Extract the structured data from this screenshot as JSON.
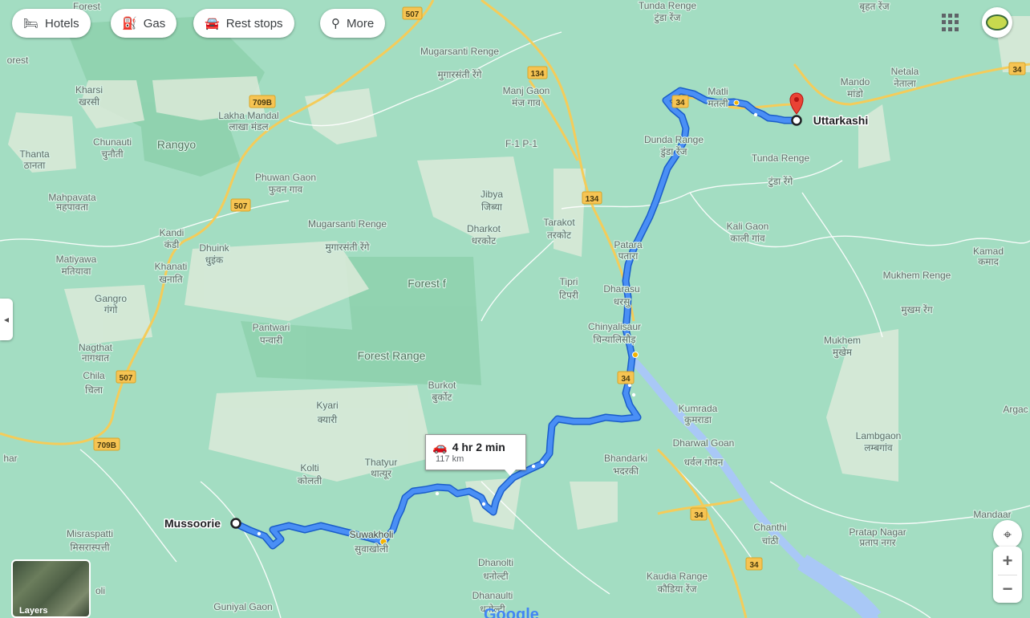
{
  "toolbar": {
    "chips": [
      {
        "label": "Hotels",
        "icon": "bed-icon"
      },
      {
        "label": "Gas",
        "icon": "fuel-icon"
      },
      {
        "label": "Rest stops",
        "icon": "car-icon"
      },
      {
        "label": "More",
        "icon": "search-icon"
      }
    ]
  },
  "route": {
    "origin": "Mussoorie",
    "destination": "Uttarkashi",
    "duration": "4 hr 2 min",
    "distance": "117 km"
  },
  "controls": {
    "layers_label": "Layers",
    "zoom_in": "+",
    "zoom_out": "−",
    "logo": "Google"
  },
  "colors": {
    "route": "#4285f4",
    "route_outline": "#1a5dc9",
    "river": "#aac8f5",
    "terrain_green": "#9fdcbf",
    "terrain_light": "#d2ead8",
    "road_yellow": "#f6c453",
    "pin_red": "#ea4335"
  },
  "road_labels": [
    "507",
    "134",
    "709B",
    "507",
    "507",
    "709B",
    "134",
    "34",
    "34",
    "34",
    "34",
    "34"
  ],
  "places": [
    {
      "en": "Forest"
    },
    {
      "en": "orest"
    },
    {
      "en": "Kharsi",
      "hi": "खरसी"
    },
    {
      "en": "Chunauti",
      "hi": "चुनौती"
    },
    {
      "en": "Rangyo"
    },
    {
      "en": "Thanta",
      "hi": "ठानता"
    },
    {
      "en": "Lakha Mandal",
      "hi": "लाखा मंडल"
    },
    {
      "en": "Mugarsanti Renge",
      "hi": "मुगारसंती रेंगे"
    },
    {
      "en": "Manj Gaon",
      "hi": "मंज गाव"
    },
    {
      "en": "Tunda Renge",
      "hi": "टुंडा रेंज"
    },
    {
      "en": "बृहत रेंज"
    },
    {
      "en": "Matli",
      "hi": "मतली"
    },
    {
      "en": "Mando",
      "hi": "मांडो"
    },
    {
      "en": "Netala",
      "hi": "नेताला"
    },
    {
      "en": "Dunda Range",
      "hi": "डुंडा रेंज"
    },
    {
      "en": "Tunda Renge",
      "hi": "टुंडा रेंगे"
    },
    {
      "en": "F-1 P-1"
    },
    {
      "en": "Phuwan Gaon",
      "hi": "फुवन गाव"
    },
    {
      "en": "Mahpavata",
      "hi": "महपावता"
    },
    {
      "en": "Jibya",
      "hi": "जिब्या"
    },
    {
      "en": "Tarakot",
      "hi": "तरकोट"
    },
    {
      "en": "Dharkot",
      "hi": "धरकोट"
    },
    {
      "en": "Kandi",
      "hi": "कंडी"
    },
    {
      "en": "Dhuink",
      "hi": "धुइंक"
    },
    {
      "en": "Mugarsanti Renge",
      "hi": "मुगारसंती रेंगे"
    },
    {
      "en": "Matiyawa",
      "hi": "मतियावा"
    },
    {
      "en": "Khanati",
      "hi": "खनाति"
    },
    {
      "en": "Patara",
      "hi": "पतारा"
    },
    {
      "en": "Kali Gaon",
      "hi": "काली गांव"
    },
    {
      "en": "Kamad",
      "hi": "कमाद"
    },
    {
      "en": "Forest f"
    },
    {
      "en": "Tipri",
      "hi": "टिपरी"
    },
    {
      "en": "Dharasu",
      "hi": "धरसु"
    },
    {
      "en": "Mukhem Renge",
      "hi": "मुखम रेंग"
    },
    {
      "en": "Gangro",
      "hi": "गंगो"
    },
    {
      "en": "Pantwari",
      "hi": "पन्वारी"
    },
    {
      "en": "Chinyalisaur",
      "hi": "चिन्यालिसौड़"
    },
    {
      "en": "Forest Range"
    },
    {
      "en": "Nagthat",
      "hi": "नागथात"
    },
    {
      "en": "Mukhem",
      "hi": "मुखेम"
    },
    {
      "en": "Chila",
      "hi": "चिला"
    },
    {
      "en": "Burkot",
      "hi": "बुर्कोट"
    },
    {
      "en": "Kumrada",
      "hi": "कुमराडा"
    },
    {
      "en": "Argac"
    },
    {
      "en": "Kyari",
      "hi": "क्यारी"
    },
    {
      "en": "Dharwal Goan",
      "hi": "धर्वल गोवन"
    },
    {
      "en": "Lambgaon",
      "hi": "लम्बगांव"
    },
    {
      "en": "Thatyur",
      "hi": "थात्यूर"
    },
    {
      "en": "Bhandarki",
      "hi": "भदरकी"
    },
    {
      "en": "har"
    },
    {
      "en": "Kolti",
      "hi": "कोलती"
    },
    {
      "en": "Mandaar"
    },
    {
      "en": "Chanthi",
      "hi": "चांठी"
    },
    {
      "en": "Pratap Nagar",
      "hi": "प्रताप नगर"
    },
    {
      "en": "Misraspatti",
      "hi": "मिसरास्पत्ती"
    },
    {
      "en": "Suwakholi",
      "hi": "सुवाखोली"
    },
    {
      "en": "Dhanolti",
      "hi": "धनोल्टी"
    },
    {
      "en": "Kaudia Range",
      "hi": "कौडिया रेंज"
    },
    {
      "en": "Dhanaulti",
      "hi": "धनोल्टी"
    },
    {
      "en": "Guniyal Gaon"
    },
    {
      "en": "oli"
    }
  ]
}
